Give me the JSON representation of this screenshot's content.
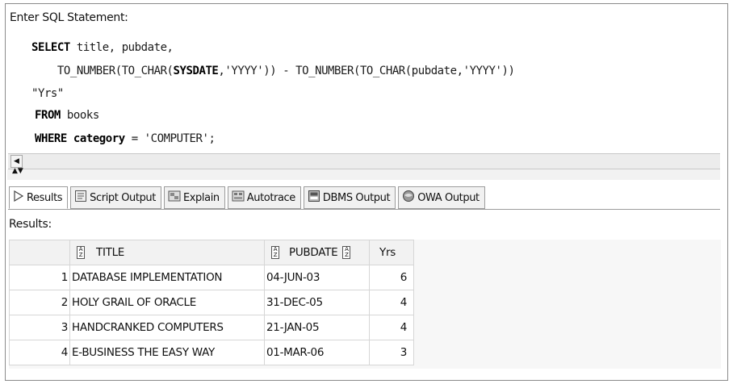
{
  "editor": {
    "label": "Enter SQL Statement:",
    "lines": {
      "l1": {
        "kw": "SELECT",
        "rest": " title, pubdate,"
      },
      "l2": {
        "pre": "    TO_NUMBER(TO_CHAR(",
        "kw": "SYSDATE",
        "post": ",'YYYY')) - TO_NUMBER(TO_CHAR(pubdate,'YYYY'))"
      },
      "l3": {
        "text": "\"Yrs\""
      },
      "l4": {
        "kw": "FROM",
        "rest": " books"
      },
      "l5": {
        "kw1": "WHERE",
        "kw2": "category",
        "rest": " = 'COMPUTER';"
      }
    }
  },
  "tabs": [
    {
      "label": "Results",
      "icon": "play-icon",
      "active": true
    },
    {
      "label": "Script Output",
      "icon": "script-icon"
    },
    {
      "label": "Explain",
      "icon": "explain-icon"
    },
    {
      "label": "Autotrace",
      "icon": "autotrace-icon"
    },
    {
      "label": "DBMS Output",
      "icon": "dbms-icon"
    },
    {
      "label": "OWA Output",
      "icon": "owa-icon"
    }
  ],
  "results": {
    "label": "Results:",
    "columns": [
      "TITLE",
      "PUBDATE",
      "Yrs"
    ],
    "rows": [
      {
        "num": "1",
        "title": "DATABASE IMPLEMENTATION",
        "pubdate": "04-JUN-03",
        "yrs": "6"
      },
      {
        "num": "2",
        "title": "HOLY GRAIL OF ORACLE",
        "pubdate": "31-DEC-05",
        "yrs": "4"
      },
      {
        "num": "3",
        "title": "HANDCRANKED COMPUTERS",
        "pubdate": "21-JAN-05",
        "yrs": "4"
      },
      {
        "num": "4",
        "title": "E-BUSINESS THE EASY WAY",
        "pubdate": "01-MAR-06",
        "yrs": "3"
      }
    ]
  }
}
